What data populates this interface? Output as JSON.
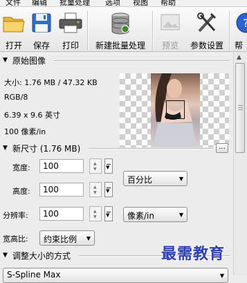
{
  "menubar": {
    "items": [
      "文件",
      "编辑",
      "批量处理",
      "选项",
      "视图",
      "帮助"
    ]
  },
  "toolbar": {
    "open_label": "打开",
    "save_label": "保存",
    "print_label": "打印",
    "batch_label": "新建批量处理",
    "preview_label": "预览",
    "settings_label": "参数设置",
    "help_label": "帮"
  },
  "original_image": {
    "heading": "原始图像",
    "size": "大小: 1.76 MB / 47.32 KB",
    "mode": "RGB/8",
    "dimensions": "6.39 x 9.6 英寸",
    "resolution": "100 像素/in"
  },
  "new_size": {
    "heading": "新尺寸 (1.76 MB)",
    "more_label": "...",
    "width_label": "宽度:",
    "width_value": "100",
    "height_label": "高度:",
    "height_value": "100",
    "resolution_label": "分辨率:",
    "resolution_value": "100",
    "unit_dropdown": "百分比",
    "res_unit_dropdown": "像素/in",
    "aspect_label": "宽高比:",
    "aspect_dropdown": "约束比例"
  },
  "resize_method": {
    "heading": "调整大小的方式",
    "dropdown": "S-Spline Max"
  },
  "watermark": "最需教育",
  "colors": {
    "toolbar_bg": "#f0f0f0",
    "panel_bg": "#ececec",
    "watermark": "#2b3fb3"
  }
}
